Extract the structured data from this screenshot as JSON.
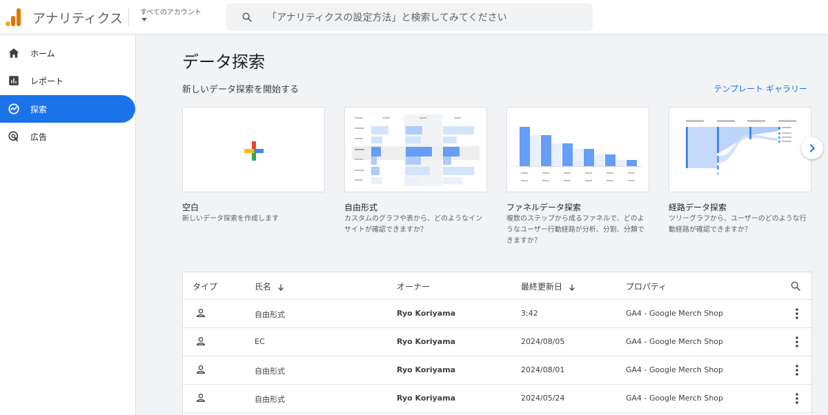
{
  "header": {
    "app_title": "アナリティクス",
    "account_label": "すべてのアカウント",
    "search_placeholder": "「アナリティクスの設定方法」と検索してみてください",
    "brand_colors": {
      "logo_dark": "#e37400",
      "logo_light": "#f9ab00"
    }
  },
  "sidebar": {
    "items": [
      {
        "label": "ホーム",
        "icon": "home-icon",
        "active": false
      },
      {
        "label": "レポート",
        "icon": "bar-chart-icon",
        "active": false
      },
      {
        "label": "探索",
        "icon": "explore-icon",
        "active": true
      },
      {
        "label": "広告",
        "icon": "ads-icon",
        "active": false
      }
    ],
    "active_color": "#1a73e8"
  },
  "main": {
    "page_title": "データ探索",
    "section_title": "新しいデータ探索を開始する",
    "gallery_link": "テンプレート ギャラリー",
    "templates": [
      {
        "title": "空白",
        "description": "新しいデータ探索を作成します",
        "icon": "plus-icon"
      },
      {
        "title": "自由形式",
        "description": "カスタムのグラフや表から、どのようなインサイトが確認できますか？",
        "icon": "free-form-thumbnail"
      },
      {
        "title": "ファネルデータ探索",
        "description": "複数のステップから成るファネルで、どのようなユーザー行動経路が分析、分割、分類できますか？",
        "icon": "funnel-thumbnail"
      },
      {
        "title": "経路データ探索",
        "description": "ツリーグラフから、ユーザーのどのような行動経路が確認できますか？",
        "icon": "path-thumbnail"
      }
    ]
  },
  "table": {
    "columns": [
      "タイプ",
      "氏名",
      "オーナー",
      "最終更新日",
      "プロパティ"
    ],
    "rows": [
      {
        "name": "自由形式",
        "owner": "Ryo Koriyama",
        "updated": "3:42",
        "property": "GA4 - Google Merch Shop"
      },
      {
        "name": "EC",
        "owner": "Ryo Koriyama",
        "updated": "2024/08/05",
        "property": "GA4 - Google Merch Shop"
      },
      {
        "name": "自由形式",
        "owner": "Ryo Koriyama",
        "updated": "2024/08/01",
        "property": "GA4 - Google Merch Shop"
      },
      {
        "name": "自由形式",
        "owner": "Ryo Koriyama",
        "updated": "2024/05/24",
        "property": "GA4 - Google Merch Shop"
      }
    ]
  }
}
